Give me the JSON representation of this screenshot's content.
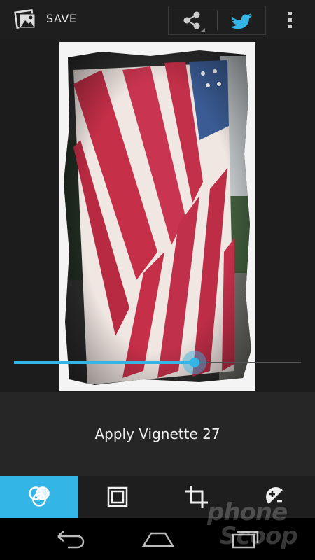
{
  "action_bar": {
    "gallery_icon": "gallery-picture-icon",
    "save_label": "SAVE",
    "share_icon": "share-icon",
    "twitter_icon": "twitter-bird-icon",
    "overflow_icon": "overflow-menu-icon"
  },
  "editor": {
    "effect": "Vignette",
    "slider_value": 27,
    "slider_fraction": 0.63,
    "status_text": "Apply Vignette 27"
  },
  "tools": [
    {
      "name": "filters",
      "icon": "filters-icon",
      "active": true
    },
    {
      "name": "borders",
      "icon": "border-frame-icon",
      "active": false
    },
    {
      "name": "crop",
      "icon": "crop-icon",
      "active": false
    },
    {
      "name": "adjust",
      "icon": "exposure-adjust-icon",
      "active": false
    }
  ],
  "nav": {
    "back_icon": "back-icon",
    "home_icon": "home-icon",
    "recents_icon": "recents-icon"
  },
  "watermark": {
    "line1": "phone",
    "line2": "Scoop"
  },
  "colors": {
    "accent": "#33b5e5",
    "background": "#1c1c1c",
    "panel": "#262626"
  }
}
